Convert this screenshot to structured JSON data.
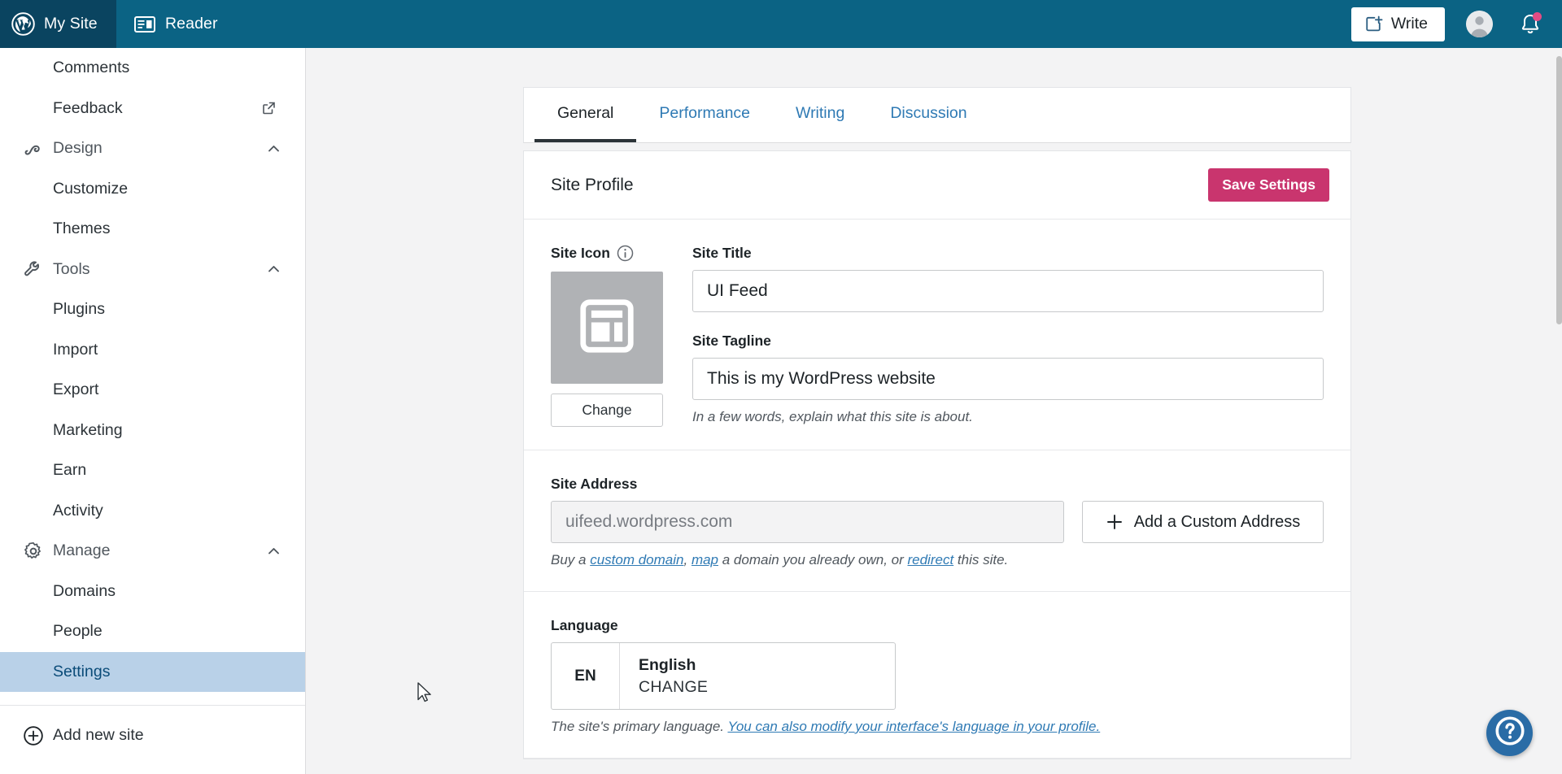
{
  "masthead": {
    "my_site_label": "My Site",
    "reader_label": "Reader",
    "write_label": "Write",
    "logo_icon": "wordpress-logo-icon",
    "reader_icon": "reader-icon",
    "write_icon": "write-plus-icon",
    "avatar_icon": "user-avatar",
    "bell_icon": "notifications-bell-icon",
    "background_color": "#0b6384",
    "mysite_background_color": "#0a4460",
    "badge_color": "#e34c84"
  },
  "sidebar": {
    "items": [
      {
        "label": "Comments",
        "type": "sub",
        "icon": ""
      },
      {
        "label": "Feedback",
        "type": "sub",
        "icon": "external-link-icon"
      },
      {
        "label": "Design",
        "type": "section",
        "icon": "design-brush-icon",
        "expanded": true
      },
      {
        "label": "Customize",
        "type": "sub",
        "icon": ""
      },
      {
        "label": "Themes",
        "type": "sub",
        "icon": ""
      },
      {
        "label": "Tools",
        "type": "section",
        "icon": "wrench-icon",
        "expanded": true
      },
      {
        "label": "Plugins",
        "type": "sub",
        "icon": ""
      },
      {
        "label": "Import",
        "type": "sub",
        "icon": ""
      },
      {
        "label": "Export",
        "type": "sub",
        "icon": ""
      },
      {
        "label": "Marketing",
        "type": "sub",
        "icon": ""
      },
      {
        "label": "Earn",
        "type": "sub",
        "icon": ""
      },
      {
        "label": "Activity",
        "type": "sub",
        "icon": ""
      },
      {
        "label": "Manage",
        "type": "section",
        "icon": "gear-icon",
        "expanded": true
      },
      {
        "label": "Domains",
        "type": "sub",
        "icon": ""
      },
      {
        "label": "People",
        "type": "sub",
        "icon": ""
      },
      {
        "label": "Settings",
        "type": "sub",
        "icon": "",
        "selected": true
      }
    ],
    "add_new_site": {
      "label": "Add new site",
      "icon": "plus-circle-icon"
    },
    "selected_background_color": "#b9d1e8",
    "selected_text_color": "#0a4b78"
  },
  "main": {
    "tabs": [
      {
        "label": "General",
        "active": true
      },
      {
        "label": "Performance",
        "active": false
      },
      {
        "label": "Writing",
        "active": false
      },
      {
        "label": "Discussion",
        "active": false
      }
    ],
    "card": {
      "title": "Site Profile",
      "save_label": "Save Settings",
      "save_color": "#c9356e"
    },
    "site_icon": {
      "label": "Site Icon",
      "info_icon": "info-circle-icon",
      "placeholder_icon": "site-layout-placeholder-icon",
      "change_label": "Change",
      "box_color": "#b0b2b5"
    },
    "site_title": {
      "label": "Site Title",
      "value": "UI Feed"
    },
    "site_tagline": {
      "label": "Site Tagline",
      "value": "This is my WordPress website",
      "help": "In a few words, explain what this site is about."
    },
    "site_address": {
      "label": "Site Address",
      "value": "uifeed.wordpress.com",
      "add_button_label": "Add a Custom Address",
      "add_button_icon": "plus-icon",
      "help_prefix": "Buy a ",
      "help_link1": "custom domain",
      "help_mid1": ", ",
      "help_link2": "map",
      "help_mid2": " a domain you already own, or ",
      "help_link3": "redirect",
      "help_suffix": " this site."
    },
    "language": {
      "label": "Language",
      "code": "EN",
      "name": "English",
      "change_label": "CHANGE",
      "help_prefix": "The site's primary language. ",
      "help_link": "You can also modify your interface's language in your profile."
    }
  },
  "help": {
    "icon": "help-question-icon",
    "color": "#2a6ca6"
  }
}
